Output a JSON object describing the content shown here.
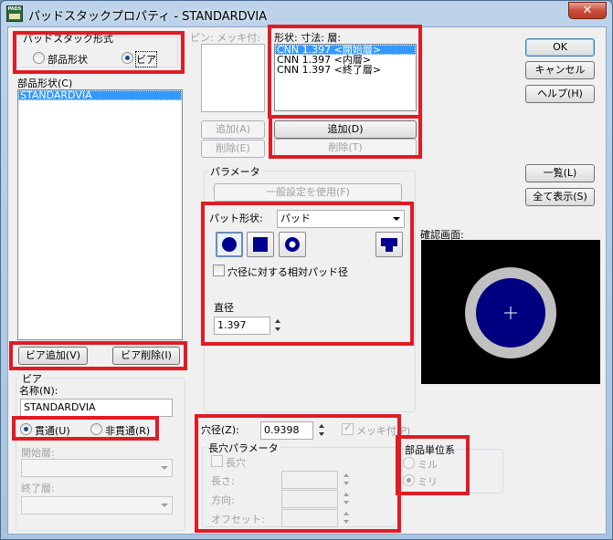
{
  "window": {
    "title": "パッドスタックプロパティ - STANDARDVIA",
    "icon_text": "PADS",
    "close_glyph": "✕"
  },
  "padstack_type": {
    "label": "パッドスタック形式",
    "options": [
      {
        "label": "部品形状",
        "selected": false
      },
      {
        "label": "ビア",
        "selected": true
      }
    ]
  },
  "part_shape": {
    "label": "部品形状(C)",
    "items": [
      "STANDARDVIA"
    ]
  },
  "plating_list": {
    "label": "ピン: メッキ付:",
    "add_label": "追加(A)",
    "delete_label": "削除(E)"
  },
  "shape_size_layer": {
    "label": "形状: 寸法: 層:",
    "items": [
      {
        "text": "CNN 1.397 <開始層>",
        "selected": true
      },
      {
        "text": "CNN 1.397 <内層>",
        "selected": false
      },
      {
        "text": "CNN 1.397 <終了層>",
        "selected": false
      }
    ],
    "add_label": "追加(D)",
    "delete_label": "削除(T)"
  },
  "dialog_buttons": {
    "ok": "OK",
    "cancel": "キャンセル",
    "help": "ヘルプ(H)",
    "list": "一覧(L)",
    "show_all": "全て表示(S)"
  },
  "parameters": {
    "label": "パラメータ",
    "use_general": "一般設定を使用(F)",
    "pad_shape_label": "パット形状:",
    "pad_shape_value": "パッド",
    "relative_pad_label": "穴径に対する相対パッド径",
    "diameter_label": "直径",
    "diameter_value": "1.397"
  },
  "preview": {
    "label": "確認画面:",
    "colors": {
      "outer": "#c0c0c0",
      "inner": "#000080",
      "background": "#000000"
    }
  },
  "via_buttons": {
    "add": "ビア追加(V)",
    "delete": "ビア削除(I)"
  },
  "via": {
    "label": "ビア",
    "name_label": "名称(N):",
    "name_value": "STANDARDVIA",
    "through_label": "貫通(U)",
    "non_through_label": "非貫通(R)",
    "start_layer_label": "開始層:",
    "end_layer_label": "終了層:"
  },
  "drill": {
    "label": "穴径(Z):",
    "value": "0.9398",
    "plated_label": "メッキ付(P)"
  },
  "slot": {
    "label": "長穴パラメータ",
    "slot_label": "長穴",
    "length_label": "長さ:",
    "direction_label": "方向:",
    "offset_label": "オフセット:"
  },
  "units": {
    "label": "部品単位系",
    "mil_label": "ミル",
    "mm_label": "ミリ"
  },
  "highlight_color": "#e01b24"
}
